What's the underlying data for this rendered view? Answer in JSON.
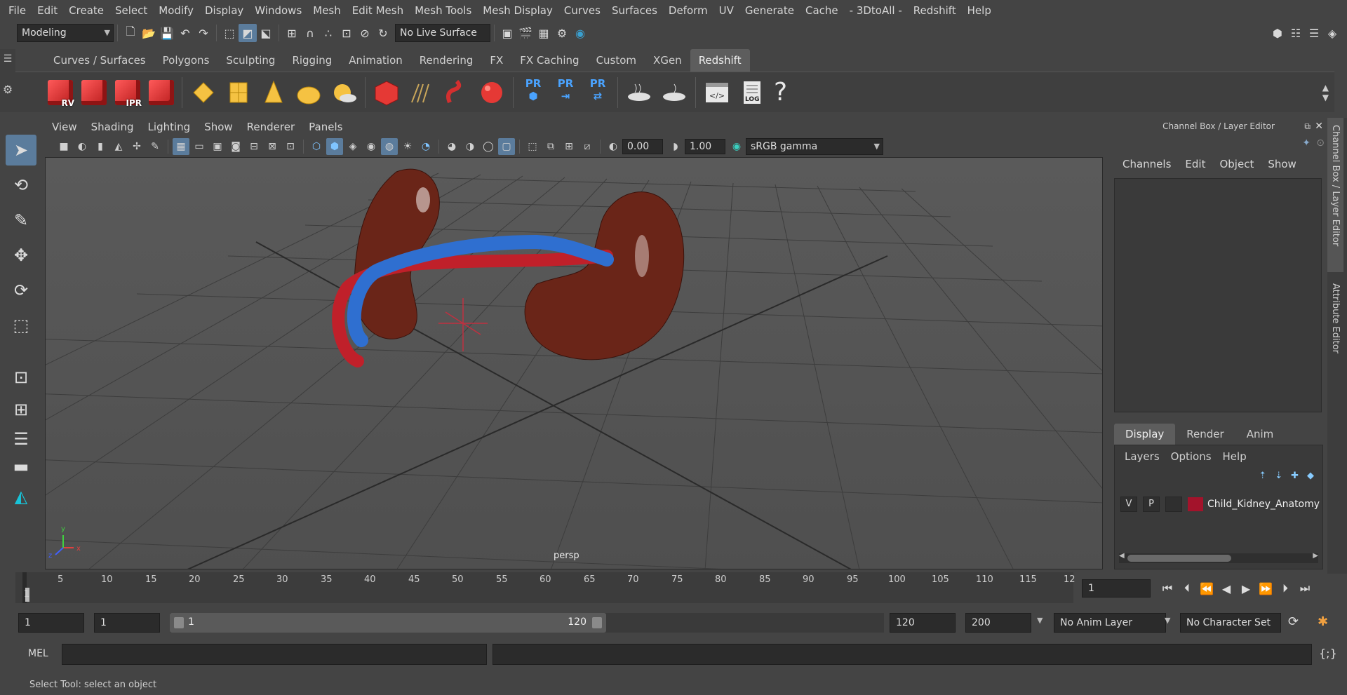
{
  "menubar": [
    "File",
    "Edit",
    "Create",
    "Select",
    "Modify",
    "Display",
    "Windows",
    "Mesh",
    "Edit Mesh",
    "Mesh Tools",
    "Mesh Display",
    "Curves",
    "Surfaces",
    "Deform",
    "UV",
    "Generate",
    "Cache",
    "- 3DtoAll -",
    "Redshift",
    "Help"
  ],
  "status": {
    "mode": "Modeling",
    "live_surface": "No Live Surface"
  },
  "shelf": {
    "tabs": [
      "Curves / Surfaces",
      "Polygons",
      "Sculpting",
      "Rigging",
      "Animation",
      "Rendering",
      "FX",
      "FX Caching",
      "Custom",
      "XGen",
      "Redshift"
    ],
    "active_tab": "Redshift",
    "cube_labels": [
      "RV",
      "",
      "IPR",
      ""
    ],
    "pr_label": "PR",
    "log_label": "LOG",
    "help_glyph": "?"
  },
  "viewport": {
    "menu": [
      "View",
      "Shading",
      "Lighting",
      "Show",
      "Renderer",
      "Panels"
    ],
    "exposure": "0.00",
    "gamma": "1.00",
    "colorspace": "sRGB gamma",
    "camera": "persp",
    "axis_x": "x",
    "axis_y": "y",
    "axis_z": "z"
  },
  "channelbox": {
    "title": "Channel Box / Layer Editor",
    "menu": [
      "Channels",
      "Edit",
      "Object",
      "Show"
    ]
  },
  "sidetabs": [
    "Channel Box / Layer Editor",
    "Attribute Editor"
  ],
  "layers": {
    "tabs": [
      "Display",
      "Render",
      "Anim"
    ],
    "menu": [
      "Layers",
      "Options",
      "Help"
    ],
    "row": {
      "v": "V",
      "p": "P",
      "name": "Child_Kidney_Anatomy",
      "color": "#a3132b"
    }
  },
  "timeline": {
    "ticks": [
      "5",
      "10",
      "15",
      "20",
      "25",
      "30",
      "35",
      "40",
      "45",
      "50",
      "55",
      "60",
      "65",
      "70",
      "75",
      "80",
      "85",
      "90",
      "95",
      "100",
      "105",
      "110",
      "115",
      "12"
    ],
    "current": "1",
    "current_frame": "1"
  },
  "range": {
    "start": "1",
    "start2": "1",
    "inner_start": "1",
    "inner_end": "120",
    "end": "120",
    "end2": "200",
    "anim_layer": "No Anim Layer",
    "char_set": "No Character Set"
  },
  "cmd": {
    "label": "MEL"
  },
  "help": "Select Tool: select an object",
  "colors": {
    "accent": "#5b7c9c",
    "rs_red": "#e53935",
    "yellow": "#f5c242",
    "blue": "#3b8ee8"
  }
}
